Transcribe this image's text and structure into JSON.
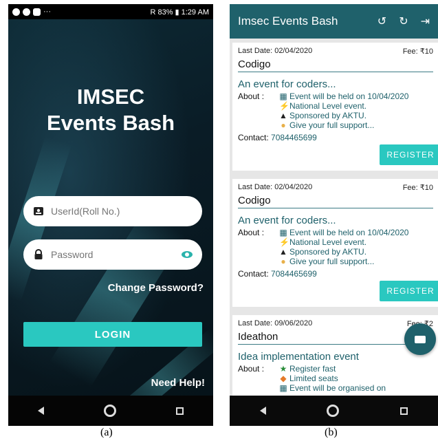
{
  "captions": {
    "a": "(a)",
    "b": "(b)"
  },
  "login_screen": {
    "status_bar": {
      "right_text": "R 83% ▮ 1:29 AM",
      "left_icons": [
        "facebook-icon",
        "pinterest-icon",
        "instagram-icon"
      ],
      "dots": "···"
    },
    "app_title_line1": "IMSEC",
    "app_title_line2": "Events Bash",
    "userid_placeholder": "UserId(Roll No.)",
    "password_placeholder": "Password",
    "change_password_link": "Change Password?",
    "login_button": "LOGIN",
    "need_help_link": "Need Help!",
    "colors": {
      "accent": "#2ac8c0",
      "background": "#0b1a24"
    }
  },
  "events_screen": {
    "app_bar": {
      "title": "Imsec Events Bash",
      "icons": [
        "history-icon",
        "refresh-icon",
        "logout-icon"
      ]
    },
    "events": [
      {
        "last_date": "Last Date: 02/04/2020",
        "fee": "Fee: ₹10",
        "name": "Codigo",
        "description": "An event for coders...",
        "about_label": "About  :",
        "about_lines": [
          "Event will be held on 10/04/2020",
          "National Level event.",
          "Sponsored by AKTU.",
          "Give your full support..."
        ],
        "about_icons": [
          "calendar-icon",
          "lightning-icon",
          "graduation-cap-icon",
          "thumbs-up-icon"
        ],
        "contact_label": "Contact:",
        "contact_number": "7084465699",
        "register_button": "REGISTER"
      },
      {
        "last_date": "Last Date: 02/04/2020",
        "fee": "Fee: ₹10",
        "name": "Codigo",
        "description": "An event for coders...",
        "about_label": "About  :",
        "about_lines": [
          "Event will be held on 10/04/2020",
          "National Level event.",
          "Sponsored by AKTU.",
          "Give your full support..."
        ],
        "about_icons": [
          "calendar-icon",
          "lightning-icon",
          "graduation-cap-icon",
          "thumbs-up-icon"
        ],
        "contact_label": "Contact:",
        "contact_number": "7084465699",
        "register_button": "REGISTER"
      },
      {
        "last_date": "Last Date: 09/06/2020",
        "fee": "Fee: ₹2",
        "name": "Ideathon",
        "description": "Idea implementation event",
        "about_label": "About  :",
        "about_lines": [
          "Register fast",
          "Limited seats",
          "Event will be organised on"
        ],
        "about_icons": [
          "runner-icon",
          "fire-icon",
          "calendar-icon"
        ]
      }
    ],
    "fab_icon": "mail-icon",
    "colors": {
      "app_bar": "#1f616b",
      "accent": "#2ac8c0"
    }
  }
}
